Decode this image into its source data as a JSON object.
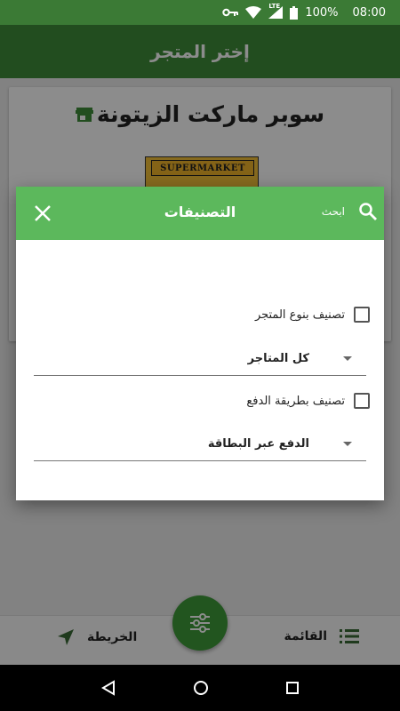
{
  "status_bar": {
    "lte": "LTE",
    "battery": "100%",
    "time": "08:00"
  },
  "app_bar": {
    "title": "إختر المتجر"
  },
  "store": {
    "name": "سوبر ماركت الزيتونة",
    "sign_text": "SUPERMARKET"
  },
  "dialog": {
    "title": "التصنيفات",
    "search_label": "ابحث",
    "filter_store_type": {
      "label": "تصنيف بنوع المتجر",
      "checked": false
    },
    "store_type_select": {
      "value": "كل المتاجر"
    },
    "filter_payment": {
      "label": "تصنيف بطريقة الدفع",
      "checked": false
    },
    "payment_select": {
      "value": "الدفع عبر البطاقة"
    }
  },
  "bottom_nav": {
    "list_label": "القائمة",
    "map_label": "الخريطة"
  },
  "colors": {
    "primary": "#3e8c3a",
    "dialog_header": "#5cb85c",
    "fab": "#3e9c3a"
  }
}
